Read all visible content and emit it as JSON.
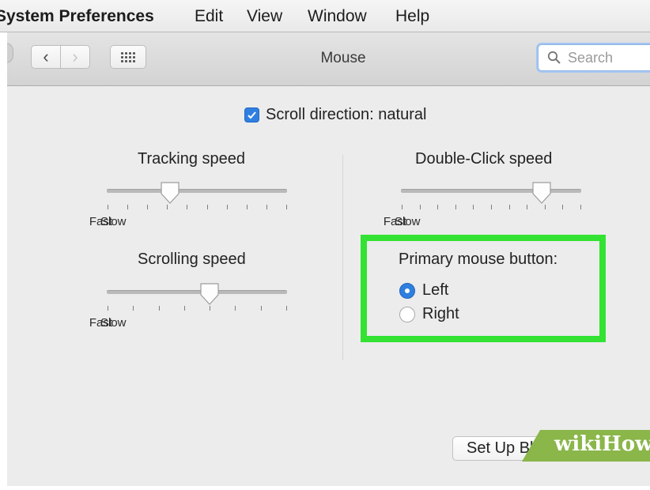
{
  "menubar": {
    "app_name": "System Preferences",
    "items": [
      "Edit",
      "View",
      "Window",
      "Help"
    ]
  },
  "toolbar": {
    "title": "Mouse",
    "search_placeholder": "Search"
  },
  "settings": {
    "scroll_direction": {
      "label": "Scroll direction: natural",
      "checked": true
    },
    "tracking": {
      "label": "Tracking speed",
      "slow": "Slow",
      "fast": "Fast",
      "level": 0.35
    },
    "scrolling": {
      "label": "Scrolling speed",
      "slow": "Slow",
      "fast": "Fast",
      "level": 0.57
    },
    "double_click": {
      "label": "Double-Click speed",
      "slow": "Slow",
      "fast": "Fast",
      "level": 0.78
    },
    "primary_button": {
      "label": "Primary mouse button:",
      "options": [
        "Left",
        "Right"
      ],
      "selected": "Left"
    }
  },
  "bluetooth_button": "Set Up Bluetooth Mouse...",
  "watermark": {
    "part1": "wiki",
    "part2": "How"
  },
  "colors": {
    "accent": "#2f7fe0",
    "highlight": "#33e233",
    "watermark": "#8ab64a"
  }
}
